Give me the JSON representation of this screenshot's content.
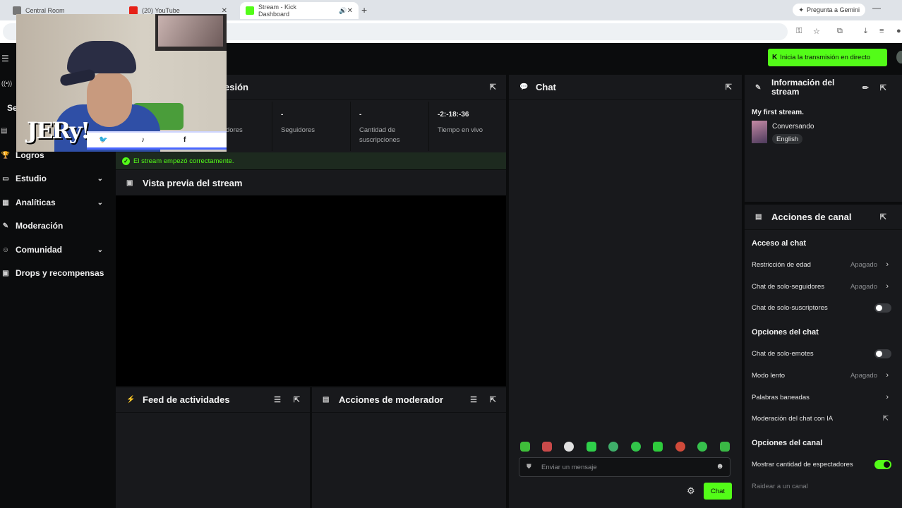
{
  "browser": {
    "tabs": [
      {
        "label": "Central Room",
        "active": false
      },
      {
        "label": "(20) YouTube",
        "active": false
      },
      {
        "label": "Stream - Kick Dashboard",
        "active": true
      }
    ],
    "gemini_label": "Pregunta a Gemini"
  },
  "header": {
    "go_live_label": "Inicia la transmisión en directo"
  },
  "sidebar": {
    "items": [
      {
        "label": "Logros",
        "icon": "trophy-icon",
        "expandable": false
      },
      {
        "label": "Estudio",
        "icon": "studio-icon",
        "expandable": true
      },
      {
        "label": "Analíticas",
        "icon": "chart-icon",
        "expandable": true
      },
      {
        "label": "Moderación",
        "icon": "wrench-icon",
        "expandable": false
      },
      {
        "label": "Comunidad",
        "icon": "people-icon",
        "expandable": true
      },
      {
        "label": "Drops y recompensas",
        "icon": "gift-icon",
        "expandable": false
      }
    ],
    "partial_labels": [
      "Se"
    ]
  },
  "session": {
    "title": "esión",
    "stats": [
      {
        "value": "",
        "label": "dores"
      },
      {
        "value": "-",
        "label": "Seguidores"
      },
      {
        "value": "-",
        "label": "Cantidad de suscripciones"
      },
      {
        "value": "-2:-18:-36",
        "label": "Tiempo en vivo"
      }
    ],
    "banner": "El stream empezó correctamente."
  },
  "preview": {
    "title": "Vista previa del stream"
  },
  "activity": {
    "title": "Feed de actividades"
  },
  "moderator": {
    "title": "Acciones de moderador"
  },
  "chat": {
    "title": "Chat",
    "placeholder": "Enviar un mensaje",
    "send_label": "Chat"
  },
  "stream_info": {
    "title": "Información del stream",
    "stream_title": "My first stream.",
    "category": "Conversando",
    "language": "English"
  },
  "channel_actions": {
    "title": "Acciones de canal",
    "sections": [
      {
        "title": "Acceso al chat",
        "rows": [
          {
            "label": "Restricción de edad",
            "value": "Apagado",
            "control": "arrow"
          },
          {
            "label": "Chat de solo-seguidores",
            "value": "Apagado",
            "control": "arrow"
          },
          {
            "label": "Chat de solo-suscriptores",
            "value": "",
            "control": "toggle-off"
          }
        ]
      },
      {
        "title": "Opciones del chat",
        "rows": [
          {
            "label": "Chat de solo-emotes",
            "value": "",
            "control": "toggle-off"
          },
          {
            "label": "Modo lento",
            "value": "Apagado",
            "control": "arrow"
          },
          {
            "label": "Palabras baneadas",
            "value": "",
            "control": "arrow"
          },
          {
            "label": "Moderación del chat con IA",
            "value": "",
            "control": "external"
          }
        ]
      },
      {
        "title": "Opciones del canal",
        "rows": [
          {
            "label": "Mostrar cantidad de espectadores",
            "value": "",
            "control": "toggle-on"
          },
          {
            "label": "Raidear a un canal",
            "value": "",
            "control": "none"
          }
        ]
      }
    ]
  },
  "webcam": {
    "logo_text": "JERy!",
    "social_icons": [
      "twitter-icon",
      "tiktok-icon",
      "facebook-icon"
    ]
  },
  "colors": {
    "accent": "#53fc18",
    "panel": "#18191c",
    "background": "#0b0c0d"
  }
}
